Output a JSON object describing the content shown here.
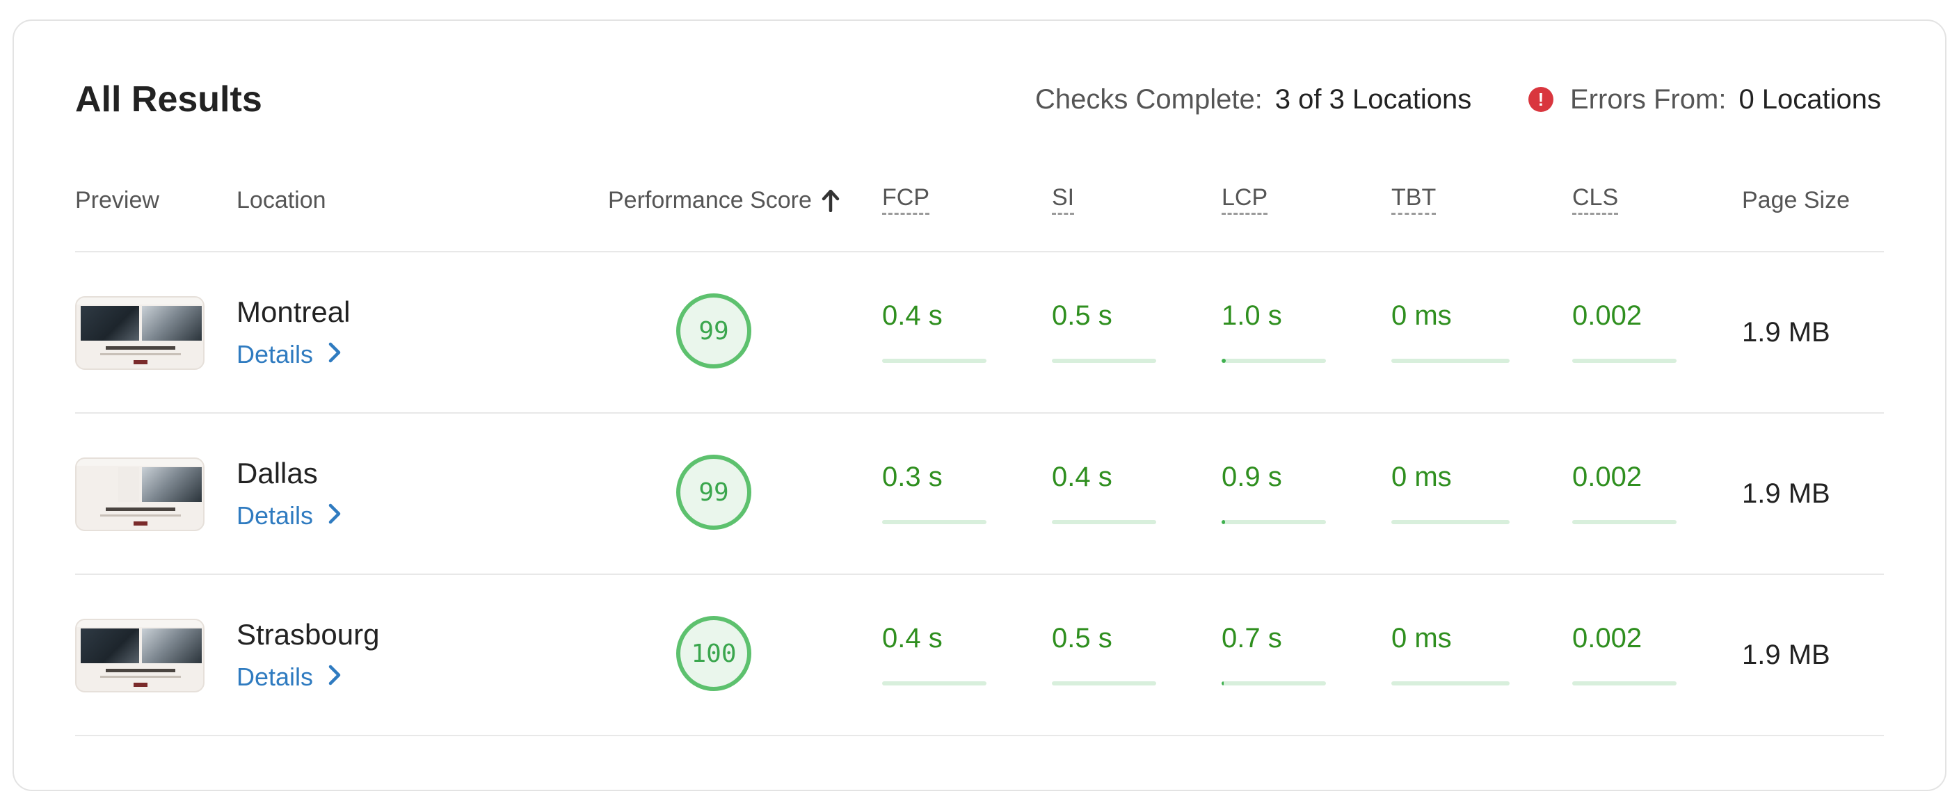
{
  "title": "All Results",
  "summary": {
    "checks_label": "Checks Complete:",
    "checks_value": "3 of 3 Locations",
    "errors_label": "Errors From:",
    "errors_value": "0 Locations",
    "error_icon": "alert-circle-icon",
    "error_color": "#d9363e"
  },
  "columns": {
    "preview": "Preview",
    "location": "Location",
    "performance": "Performance Score",
    "fcp": "FCP",
    "si": "SI",
    "lcp": "LCP",
    "tbt": "TBT",
    "cls": "CLS",
    "page_size": "Page Size",
    "sort_icon": "arrow-up-icon"
  },
  "details_label": "Details",
  "colors": {
    "good": "#2f8f1f",
    "score_ring": "#5dc16e",
    "link": "#2f7bc0"
  },
  "rows": [
    {
      "location": "Montreal",
      "score": "99",
      "fcp": "0.4 s",
      "si": "0.5 s",
      "lcp": "1.0 s",
      "tbt": "0 ms",
      "cls": "0.002",
      "page_size": "1.9 MB",
      "bars": {
        "fcp": 0,
        "si": 0,
        "lcp": 0.04,
        "tbt": 0,
        "cls": 0
      }
    },
    {
      "location": "Dallas",
      "score": "99",
      "fcp": "0.3 s",
      "si": "0.4 s",
      "lcp": "0.9 s",
      "tbt": "0 ms",
      "cls": "0.002",
      "page_size": "1.9 MB",
      "bars": {
        "fcp": 0,
        "si": 0,
        "lcp": 0.03,
        "tbt": 0,
        "cls": 0
      }
    },
    {
      "location": "Strasbourg",
      "score": "100",
      "fcp": "0.4 s",
      "si": "0.5 s",
      "lcp": "0.7 s",
      "tbt": "0 ms",
      "cls": "0.002",
      "page_size": "1.9 MB",
      "bars": {
        "fcp": 0,
        "si": 0,
        "lcp": 0.02,
        "tbt": 0,
        "cls": 0
      }
    }
  ]
}
